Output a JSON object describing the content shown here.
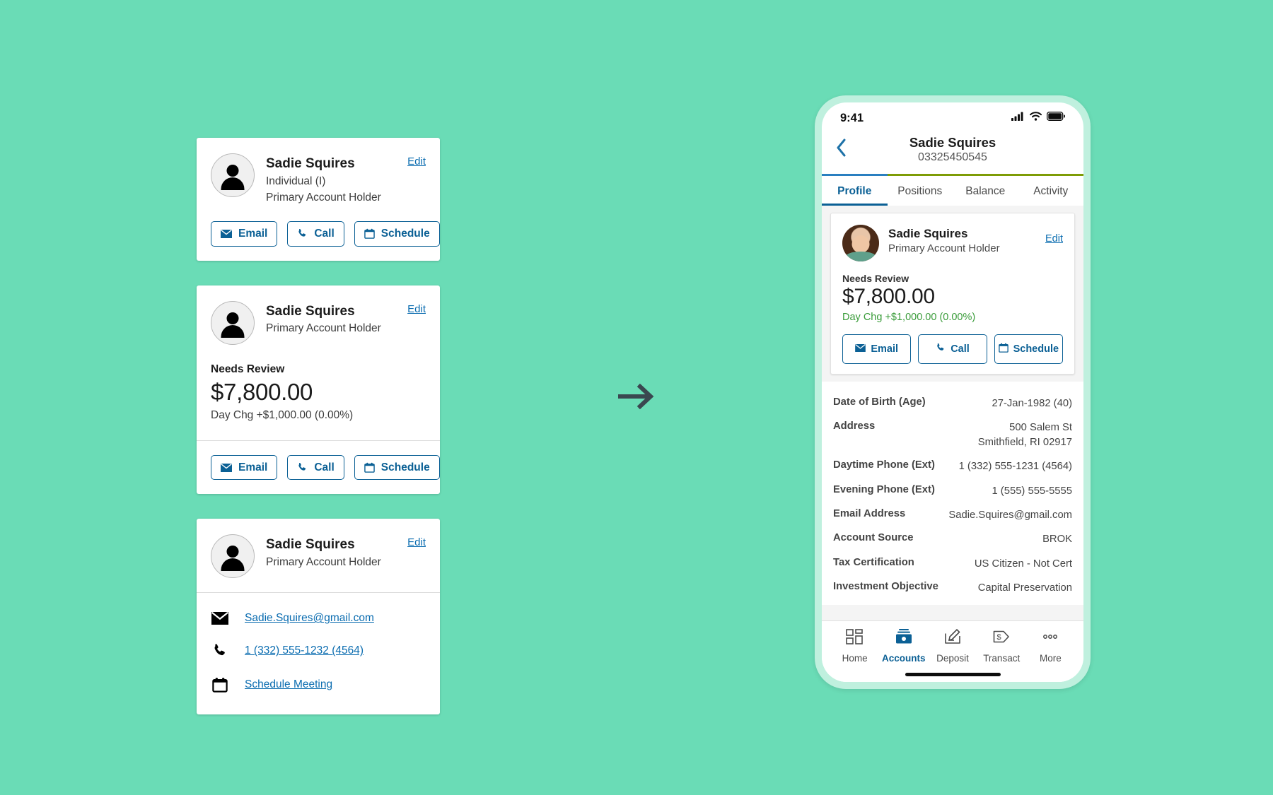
{
  "background_color": "#6adcb6",
  "accent_blue": "#0b6095",
  "link_blue": "#0a6cb0",
  "positive_green": "#3a9c3a",
  "progress_olive": "#7e9c06",
  "cards": [
    {
      "name": "Sadie Squires",
      "type": "Individual (I)",
      "role": "Primary Account Holder",
      "edit_label": "Edit",
      "actions": [
        {
          "icon": "email-icon",
          "label": "Email"
        },
        {
          "icon": "phone-icon",
          "label": "Call"
        },
        {
          "icon": "calendar-icon",
          "label": "Schedule"
        }
      ]
    },
    {
      "name": "Sadie Squires",
      "role": "Primary Account Holder",
      "edit_label": "Edit",
      "status_label": "Needs Review",
      "balance": "$7,800.00",
      "day_change": "Day Chg +$1,000.00 (0.00%)",
      "actions": [
        {
          "icon": "email-icon",
          "label": "Email"
        },
        {
          "icon": "phone-icon",
          "label": "Call"
        },
        {
          "icon": "calendar-icon",
          "label": "Schedule"
        }
      ]
    },
    {
      "name": "Sadie Squires",
      "role": "Primary Account Holder",
      "edit_label": "Edit",
      "contacts": [
        {
          "icon": "email-icon",
          "label": "Sadie.Squires@gmail.com"
        },
        {
          "icon": "phone-icon",
          "label": "1 (332) 555-1232 (4564)"
        },
        {
          "icon": "calendar-icon",
          "label": "Schedule Meeting"
        }
      ]
    }
  ],
  "arrow": {
    "name": "right-arrow",
    "color": "#3a4750"
  },
  "phone": {
    "status_bar": {
      "time": "9:41",
      "icons": [
        "cellular-signal-icon",
        "wifi-icon",
        "battery-icon"
      ]
    },
    "header": {
      "back_icon": "back-chevron-icon",
      "name": "Sadie Squires",
      "account_number": "03325450545"
    },
    "tabs": [
      {
        "label": "Profile",
        "active": true
      },
      {
        "label": "Positions",
        "active": false
      },
      {
        "label": "Balance",
        "active": false
      },
      {
        "label": "Activity",
        "active": false
      }
    ],
    "profile_card": {
      "avatar": "user-photo-avatar",
      "name": "Sadie Squires",
      "role": "Primary Account Holder",
      "edit_label": "Edit",
      "status_label": "Needs Review",
      "balance": "$7,800.00",
      "day_change": "Day Chg +$1,000.00 (0.00%)",
      "actions": [
        {
          "icon": "email-icon",
          "label": "Email"
        },
        {
          "icon": "phone-icon",
          "label": "Call"
        },
        {
          "icon": "calendar-icon",
          "label": "Schedule"
        }
      ]
    },
    "details": [
      {
        "label": "Date of Birth (Age)",
        "value": "27-Jan-1982 (40)"
      },
      {
        "label": "Address",
        "value": "500 Salem St\nSmithfield, RI 02917"
      },
      {
        "label": "Daytime Phone (Ext)",
        "value": "1 (332) 555-1231 (4564)"
      },
      {
        "label": "Evening Phone (Ext)",
        "value": "1 (555) 555-5555"
      },
      {
        "label": "Email Address",
        "value": "Sadie.Squires@gmail.com"
      },
      {
        "label": "Account Source",
        "value": "BROK"
      },
      {
        "label": "Tax Certification",
        "value": "US Citizen - Not Cert"
      },
      {
        "label": "Investment Objective",
        "value": "Capital Preservation"
      }
    ],
    "bottom_nav": [
      {
        "label": "Home",
        "icon": "home-grid-icon",
        "active": false
      },
      {
        "label": "Accounts",
        "icon": "accounts-box-icon",
        "active": true
      },
      {
        "label": "Deposit",
        "icon": "deposit-check-icon",
        "active": false
      },
      {
        "label": "Transact",
        "icon": "transact-tag-icon",
        "active": false
      },
      {
        "label": "More",
        "icon": "more-dots-icon",
        "active": false
      }
    ]
  }
}
